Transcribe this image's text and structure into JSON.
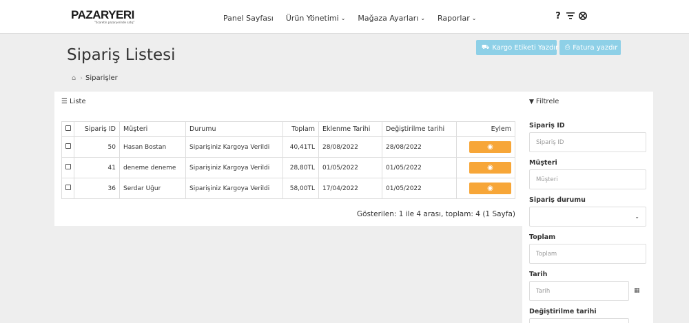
{
  "brand": {
    "name": "PAZARYERI",
    "tagline": "\"ticaretin pazaryerinde satış\""
  },
  "nav": {
    "items": [
      {
        "label": "Panel Sayfası",
        "dropdown": false
      },
      {
        "label": "Ürün Yönetimi",
        "dropdown": true
      },
      {
        "label": "Mağaza Ayarları",
        "dropdown": true
      },
      {
        "label": "Raporlar",
        "dropdown": true
      }
    ],
    "icons": [
      "question-icon",
      "filter-lines-icon",
      "globe-icon"
    ]
  },
  "page": {
    "title": "Sipariş Listesi",
    "breadcrumb": "Siparişler",
    "buttons": {
      "kargo": "Kargo Etiketi Yazdır",
      "fatura": "Fatura yazdır"
    }
  },
  "list": {
    "heading": "Liste",
    "columns": [
      "Sipariş ID",
      "Müşteri",
      "Durumu",
      "Toplam",
      "Eklenme Tarihi",
      "Değiştirilme tarihi",
      "Eylem"
    ],
    "rows": [
      {
        "id": "50",
        "customer": "Hasan Bostan",
        "status": "Siparişiniz Kargoya Verildi",
        "total": "40,41TL",
        "added": "28/08/2022",
        "modified": "28/08/2022"
      },
      {
        "id": "41",
        "customer": "deneme deneme",
        "status": "Siparişiniz Kargoya Verildi",
        "total": "28,80TL",
        "added": "01/05/2022",
        "modified": "01/05/2022"
      },
      {
        "id": "36",
        "customer": "Serdar Uğur",
        "status": "Siparişiniz Kargoya Verildi",
        "total": "58,00TL",
        "added": "17/04/2022",
        "modified": "01/05/2022"
      }
    ],
    "pagination": "Gösterilen: 1 ile 4 arası, toplam: 4 (1 Sayfa)"
  },
  "filter": {
    "heading": "Filtrele",
    "order_id": {
      "label": "Sipariş ID",
      "placeholder": "Sipariş ID"
    },
    "customer": {
      "label": "Müşteri",
      "placeholder": "Müşteri"
    },
    "status": {
      "label": "Sipariş durumu",
      "value": ""
    },
    "total": {
      "label": "Toplam",
      "placeholder": "Toplam"
    },
    "date": {
      "label": "Tarih",
      "placeholder": "Tarih"
    },
    "modified": {
      "label": "Değiştirilme tarihi"
    }
  },
  "colors": {
    "info_button": "#8ed0e7",
    "action_button": "#f7a638",
    "background": "#eeeeee"
  }
}
